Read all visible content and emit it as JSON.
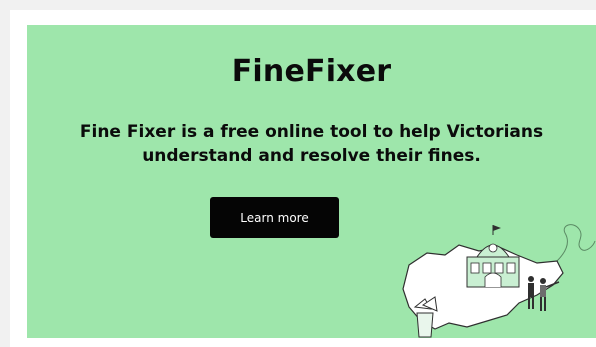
{
  "banner": {
    "title": "FineFixer",
    "description": "Fine Fixer is a free online tool to help Victorians understand and resolve their fines.",
    "cta_label": "Learn more",
    "illustration_icon": "victoria-map-with-flinders-street-station-and-people-illustration"
  },
  "colors": {
    "background": "#9ee6ab",
    "button": "#050505",
    "button_text": "#ffffff",
    "text": "#0b0b0b",
    "page_bg": "#f1f1f1"
  }
}
